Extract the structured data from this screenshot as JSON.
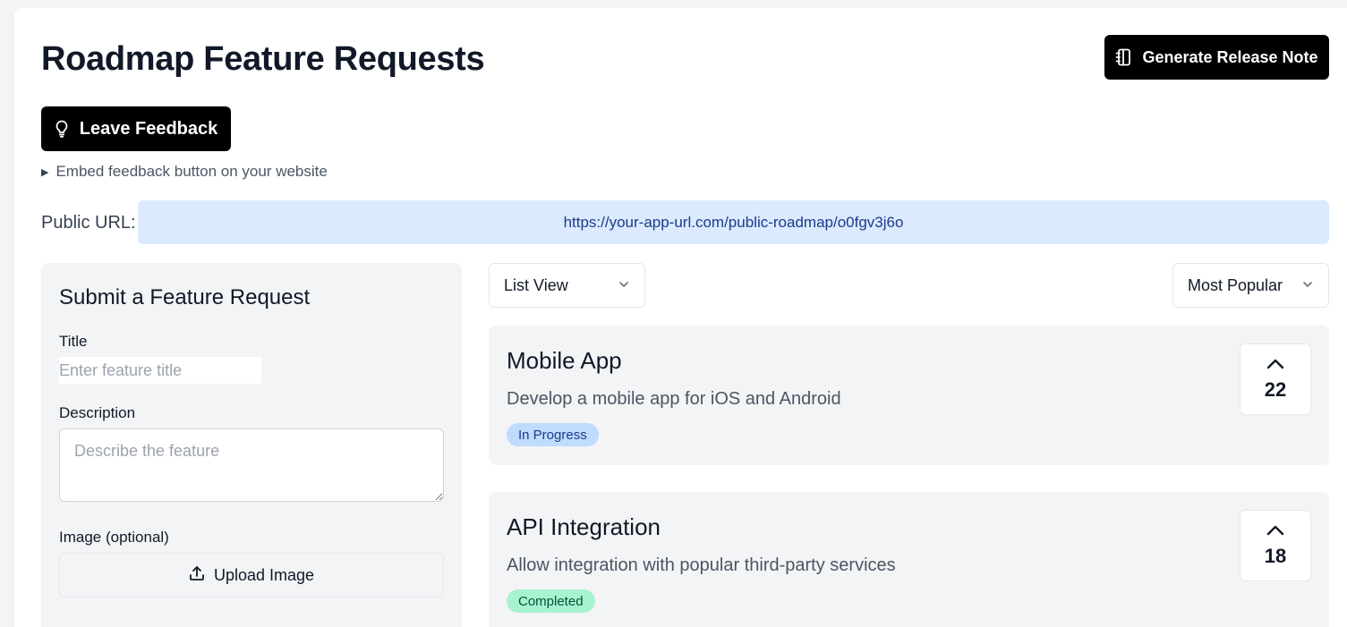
{
  "header": {
    "title": "Roadmap Feature Requests",
    "release_button": "Generate Release Note",
    "release_icon": "notebook-icon"
  },
  "feedback": {
    "button_label": "Leave Feedback",
    "button_icon": "lightbulb-icon",
    "embed_toggle": "Embed feedback button on your website"
  },
  "public_url": {
    "label": "Public URL:",
    "value": "https://your-app-url.com/public-roadmap/o0fgv3j6o"
  },
  "form": {
    "heading": "Submit a Feature Request",
    "title_label": "Title",
    "title_placeholder": "Enter feature title",
    "description_label": "Description",
    "description_placeholder": "Describe the feature",
    "image_label": "Image (optional)",
    "upload_button": "Upload Image",
    "upload_icon": "upload-icon"
  },
  "filters": {
    "view_selected": "List View",
    "sort_selected": "Most Popular"
  },
  "features": [
    {
      "title": "Mobile App",
      "description": "Develop a mobile app for iOS and Android",
      "status": "In Progress",
      "status_bg": "#bfdbfe",
      "status_fg": "#1e3a8a",
      "votes": "22"
    },
    {
      "title": "API Integration",
      "description": "Allow integration with popular third-party services",
      "status": "Completed",
      "status_bg": "#a7f3d0",
      "status_fg": "#064e3b",
      "votes": "18"
    }
  ],
  "colors": {
    "primary_button": "#000000",
    "url_background": "#dbeafe",
    "panel_background": "#f3f4f6"
  }
}
